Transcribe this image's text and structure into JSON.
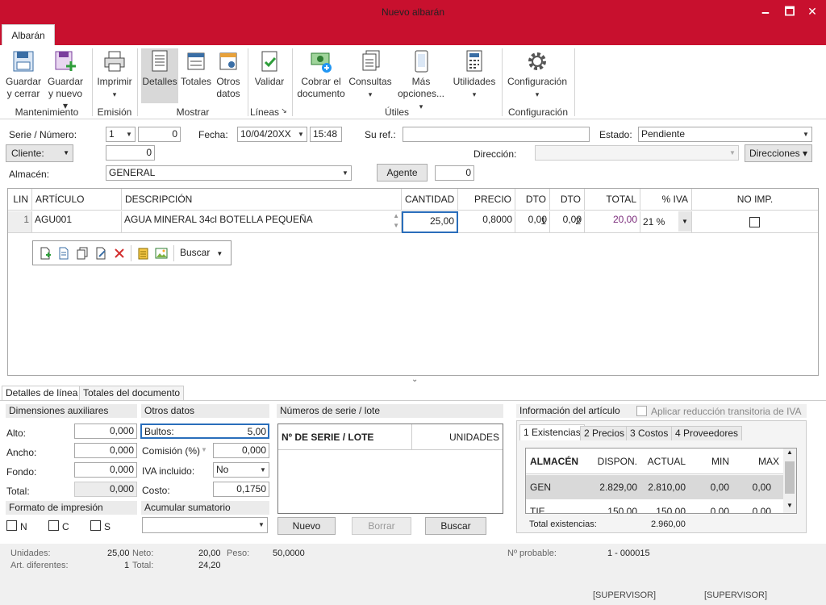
{
  "window": {
    "title": "Nuevo albarán",
    "minimize": "🗕",
    "maximize": "🗖",
    "close": "✕"
  },
  "tabs": {
    "main": "Albarán"
  },
  "ribbon": {
    "guardar_cerrar": "Guardar y cerrar",
    "guardar_nuevo": "Guardar y nuevo ▾",
    "imprimir": "Imprimir",
    "imprimir_arrow": "▾",
    "detalles": "Detalles",
    "totales": "Totales",
    "otros_datos": "Otros datos",
    "validar": "Validar",
    "cobrar": "Cobrar el documento",
    "consultas": "Consultas",
    "consultas_arrow": "▾",
    "mas": "Más opciones...",
    "mas_arrow": "▾",
    "utilidades": "Utilidades",
    "utilidades_arrow": "▾",
    "configuracion": "Configuración",
    "config_arrow": "▾",
    "groups": {
      "mantenimiento": "Mantenimiento",
      "emision": "Emisión",
      "mostrar": "Mostrar",
      "lineas": "Líneas",
      "lineas_launcher": "↘",
      "utiles": "Útiles",
      "configuracion": "Configuración"
    }
  },
  "header": {
    "serie_label": "Serie / Número:",
    "serie": "1",
    "numero": "0",
    "fecha_label": "Fecha:",
    "fecha": "10/04/20XX",
    "hora": "15:48",
    "suref_label": "Su ref.:",
    "suref": "",
    "estado_label": "Estado:",
    "estado": "Pendiente",
    "cliente_label": "Cliente:",
    "cliente": "0",
    "direccion_label": "Dirección:",
    "direccion": "",
    "direcciones_btn": "Direcciones ▾",
    "almacen_label": "Almacén:",
    "almacen": "GENERAL",
    "agente_btn": "Agente",
    "agente": "0"
  },
  "grid": {
    "columns": [
      "LIN",
      "ARTÍCULO",
      "DESCRIPCIÓN",
      "CANTIDAD",
      "PRECIO",
      "DTO 1",
      "DTO 2",
      "TOTAL",
      "% IVA",
      "NO IMP."
    ],
    "rows": [
      {
        "lin": "1",
        "articulo": "AGU001",
        "descripcion": "AGUA MINERAL 34cl BOTELLA PEQUEÑA",
        "cantidad": "25,00",
        "precio": "0,8000",
        "dto1": "0,00",
        "dto2": "0,00",
        "total": "20,00",
        "iva": "21 %",
        "noimp": false
      }
    ],
    "toolbar": {
      "buscar": "Buscar"
    }
  },
  "bottom_tabs": {
    "detalles_linea": "Detalles de línea",
    "totales_documento": "Totales del documento"
  },
  "dimensiones": {
    "title": "Dimensiones auxiliares",
    "alto_label": "Alto:",
    "alto": "0,000",
    "ancho_label": "Ancho:",
    "ancho": "0,000",
    "fondo_label": "Fondo:",
    "fondo": "0,000",
    "total_label": "Total:",
    "total": "0,000"
  },
  "otros": {
    "title": "Otros datos",
    "bultos_label": "Bultos:",
    "bultos": "5,00",
    "comision_label": "Comisión (%)",
    "comision": "0,000",
    "iva_label": "IVA incluido:",
    "iva": "No",
    "coste_label": "Costo:",
    "coste": "0,1750"
  },
  "formato": {
    "title": "Formato de impresión",
    "n": "N",
    "c": "C",
    "s": "S"
  },
  "acumular": {
    "title": "Acumular sumatorio",
    "value": ""
  },
  "series": {
    "title": "Números de serie / lote",
    "col1": "Nº DE SERIE / LOTE",
    "col2": "UNIDADES",
    "nuevo": "Nuevo",
    "borrar": "Borrar",
    "buscar": "Buscar"
  },
  "info": {
    "title": "Información del artículo",
    "reduccion": "Aplicar reducción transitoria de IVA",
    "tabs": [
      "1 Existencias",
      "2 Precios",
      "3 Costos",
      "4 Proveedores"
    ],
    "columns": [
      "ALMACÉN",
      "DISPON.",
      "ACTUAL",
      "MIN",
      "MAX"
    ],
    "rows": [
      [
        "GEN",
        "2.829,00",
        "2.810,00",
        "0,00",
        "0,00"
      ],
      [
        "TIE",
        "150,00",
        "150,00",
        "0,00",
        "0,00"
      ]
    ],
    "total_label": "Total existencias:",
    "total": "2.960,00"
  },
  "status": {
    "unidades_label": "Unidades:",
    "unidades": "25,00",
    "neto_label": "Neto:",
    "neto": "20,00",
    "peso_label": "Peso:",
    "peso": "50,0000",
    "art_label": "Art. diferentes:",
    "art": "1",
    "total_label": "Total:",
    "total": "24,20",
    "nprob_label": "Nº probable:",
    "nprob": "1 - 000015",
    "user1": "[SUPERVISOR]",
    "user2": "[SUPERVISOR]"
  },
  "colors": {
    "brand": "#c8102e"
  }
}
